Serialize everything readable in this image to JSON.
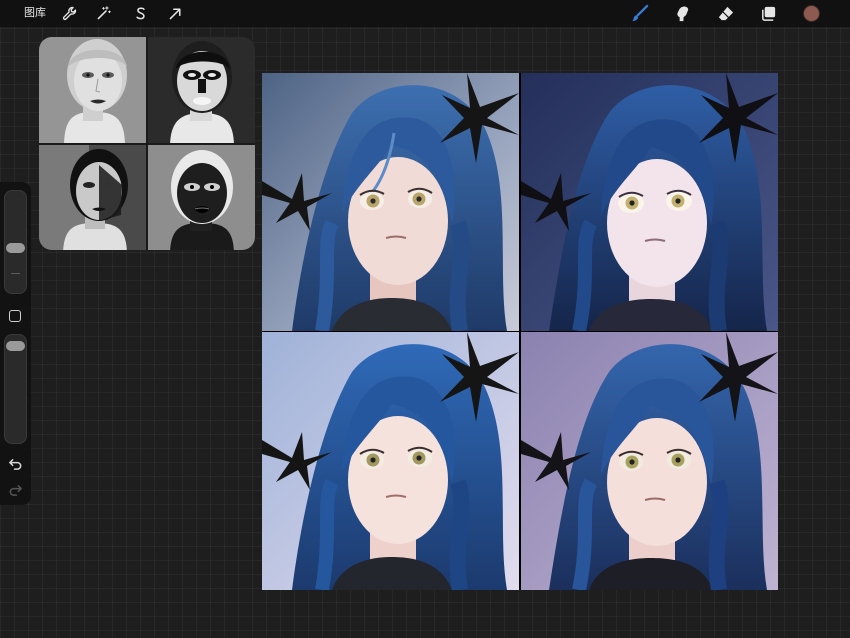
{
  "toolbar": {
    "gallery_label": "图库",
    "left_icons": [
      "wrench-icon",
      "magic-wand-icon",
      "selection-s-icon",
      "transform-arrow-icon"
    ],
    "right_icons": [
      "brush-icon",
      "smudge-icon",
      "eraser-icon",
      "layers-icon"
    ],
    "current_color": "#8c5a50",
    "accent_color": "#3a7bd5"
  },
  "sidebar": {
    "brush_size_level": 0.82,
    "opacity_level": 0.97,
    "controls": [
      "brush-size-slider",
      "modify-button",
      "opacity-slider",
      "undo-icon",
      "redo-icon"
    ]
  },
  "reference": {
    "panels": [
      "normal-reference",
      "inverted-reference",
      "high-contrast-reference",
      "dark-reference"
    ]
  },
  "artwork": {
    "panels": [
      "portrait-light",
      "portrait-dark",
      "portrait-bright",
      "portrait-purple"
    ]
  }
}
